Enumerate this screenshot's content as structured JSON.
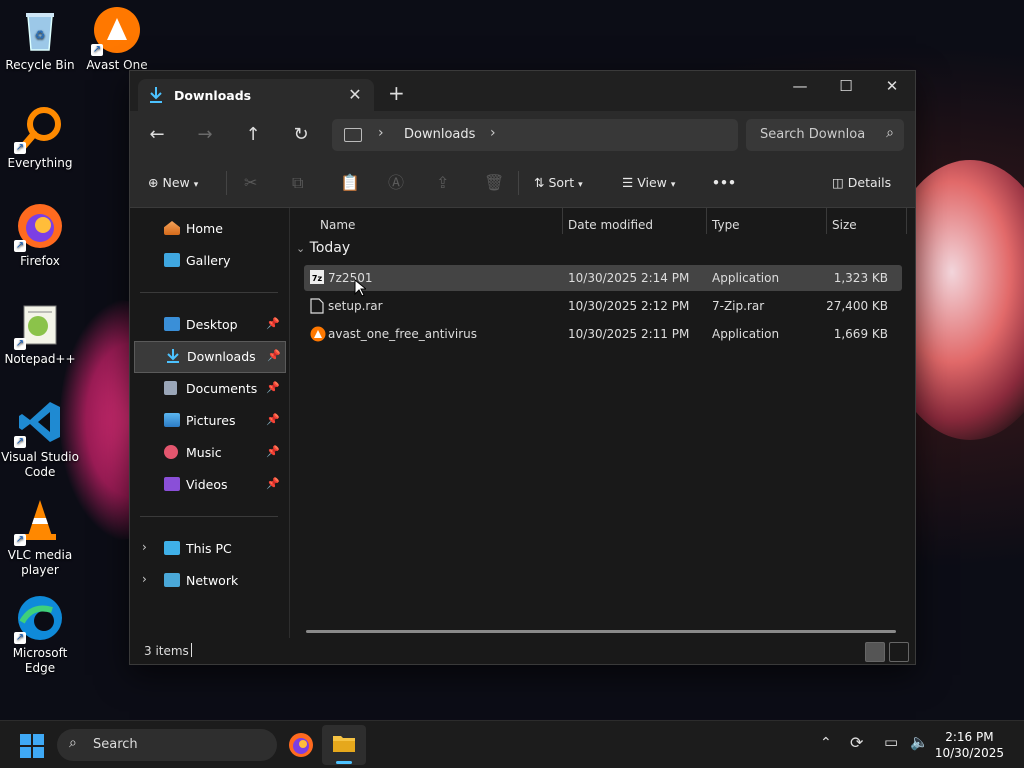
{
  "desktop": {
    "icons": [
      {
        "label": "Recycle Bin",
        "icon": "recycle-bin-icon"
      },
      {
        "label": "Avast One",
        "icon": "avast-icon"
      },
      {
        "label": "Everything",
        "icon": "everything-icon"
      },
      {
        "label": "Firefox",
        "icon": "firefox-icon"
      },
      {
        "label": "Notepad++",
        "icon": "notepad-plus-plus-icon"
      },
      {
        "label": "Visual Studio Code",
        "icon": "vscode-icon"
      },
      {
        "label": "VLC media player",
        "icon": "vlc-icon"
      },
      {
        "label": "Microsoft Edge",
        "icon": "edge-icon"
      }
    ]
  },
  "window": {
    "tab_title": "Downloads",
    "controls": {
      "minimize": "—",
      "maximize": "☐",
      "close": "✕"
    }
  },
  "address": {
    "crumbs": [
      "Downloads"
    ],
    "search_placeholder": "Search Downloa"
  },
  "toolbar": {
    "new_label": "New",
    "sort_label": "Sort",
    "view_label": "View",
    "more_label": "•••",
    "details_label": "Details"
  },
  "sidebar": {
    "items": [
      {
        "label": "Home"
      },
      {
        "label": "Gallery"
      },
      {
        "label": "Desktop",
        "pinned": true
      },
      {
        "label": "Downloads",
        "pinned": true,
        "selected": true
      },
      {
        "label": "Documents",
        "pinned": true
      },
      {
        "label": "Pictures",
        "pinned": true
      },
      {
        "label": "Music",
        "pinned": true
      },
      {
        "label": "Videos",
        "pinned": true
      },
      {
        "label": "This PC"
      },
      {
        "label": "Network"
      }
    ]
  },
  "content": {
    "columns": [
      "Name",
      "Date modified",
      "Type",
      "Size"
    ],
    "group": "Today",
    "files": [
      {
        "name": "7z2501",
        "date": "10/30/2025 2:14 PM",
        "type": "Application",
        "size": "1,323 KB"
      },
      {
        "name": "setup.rar",
        "date": "10/30/2025 2:12 PM",
        "type": "7-Zip.rar",
        "size": "27,400 KB"
      },
      {
        "name": "avast_one_free_antivirus",
        "date": "10/30/2025 2:11 PM",
        "type": "Application",
        "size": "1,669 KB"
      }
    ]
  },
  "status": {
    "item_count": "3 items"
  },
  "taskbar": {
    "search_label": "Search",
    "time": "2:16 PM",
    "date": "10/30/2025"
  },
  "colors": {
    "accent": "#4cc2ff",
    "selection": "#444444"
  }
}
